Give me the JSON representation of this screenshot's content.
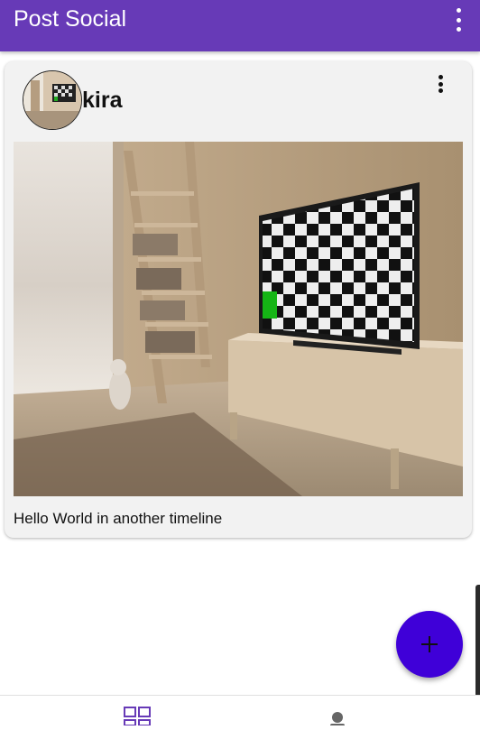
{
  "app_bar": {
    "title": "Post Social",
    "overflow_icon": "more-vert-icon",
    "background_color": "#673ab7"
  },
  "post": {
    "author": "kira",
    "caption": "Hello World in another timeline",
    "overflow_icon": "more-vert-icon"
  },
  "fab": {
    "icon": "add-icon",
    "color": "#3f00d8"
  },
  "bottom_nav": {
    "items": [
      {
        "icon": "dashboard-icon",
        "active": true
      },
      {
        "icon": "person-icon",
        "active": false
      }
    ],
    "active_color": "#673ab7"
  }
}
